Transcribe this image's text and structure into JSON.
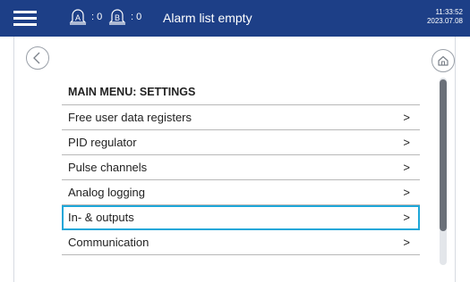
{
  "header": {
    "menu_icon": "hamburger-menu-icon",
    "alarm_a": {
      "icon": "alarm-a-icon",
      "letter": "A",
      "count": ": 0"
    },
    "alarm_b": {
      "icon": "alarm-b-icon",
      "letter": "B",
      "count": ": 0"
    },
    "alarm_status": "Alarm list empty",
    "time": "11:33:52",
    "date": "2023.07.08"
  },
  "nav": {
    "back_icon": "chevron-left-icon",
    "home_icon": "home-icon"
  },
  "menu": {
    "title": "MAIN MENU: SETTINGS",
    "selected_index": 4,
    "items": [
      {
        "label": "Free user data registers",
        "arrow": ">"
      },
      {
        "label": "PID regulator",
        "arrow": ">"
      },
      {
        "label": "Pulse channels",
        "arrow": ">"
      },
      {
        "label": "Analog logging",
        "arrow": ">"
      },
      {
        "label": "In- & outputs",
        "arrow": ">"
      },
      {
        "label": "Communication",
        "arrow": ">"
      }
    ]
  },
  "colors": {
    "header_bg": "#1d3f87",
    "selection_border": "#1ea7d9",
    "scroll_thumb": "#6b7079"
  }
}
